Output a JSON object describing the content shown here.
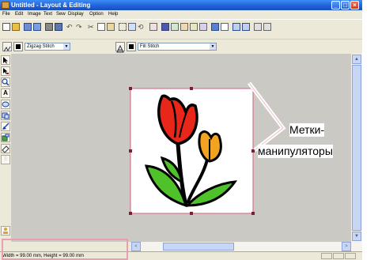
{
  "window": {
    "title": "Untitled - Layout & Editing",
    "controls": {
      "minimize": "_",
      "maximize": "□",
      "close": "×"
    }
  },
  "menu": [
    "File",
    "Edit",
    "Image",
    "Text",
    "Sew",
    "Display",
    "Option",
    "Help"
  ],
  "toolbar2": {
    "stitch_combo": "Zigzag Stitch",
    "fill_combo": "Fill Stitch"
  },
  "left_tools": [
    "select-arrow-icon",
    "point-edit-icon",
    "zoom-icon",
    "text-tool-icon",
    "ellipse-tool-icon",
    "shape-tool-icon",
    "edit-tool-icon",
    "fill-tool-icon",
    "eraser-tool-icon",
    "stitch-tool-icon",
    "user-icon"
  ],
  "scroll": {
    "left_arrow": "<",
    "up_arrow": "▲",
    "down_arrow": "▼",
    "right_arrow": ">"
  },
  "status": {
    "size_text": "Width = 99.00 mm, Height = 99.00 mm"
  },
  "annotation": {
    "label_line1": "Метки-",
    "label_line2": "манипуляторы"
  },
  "colors": {
    "selection_handle": "#7a2030",
    "tulip_red": "#e8261a",
    "tulip_orange": "#f2a321",
    "leaf_green": "#4fc12a",
    "callout_pink": "#e8a0b0"
  }
}
